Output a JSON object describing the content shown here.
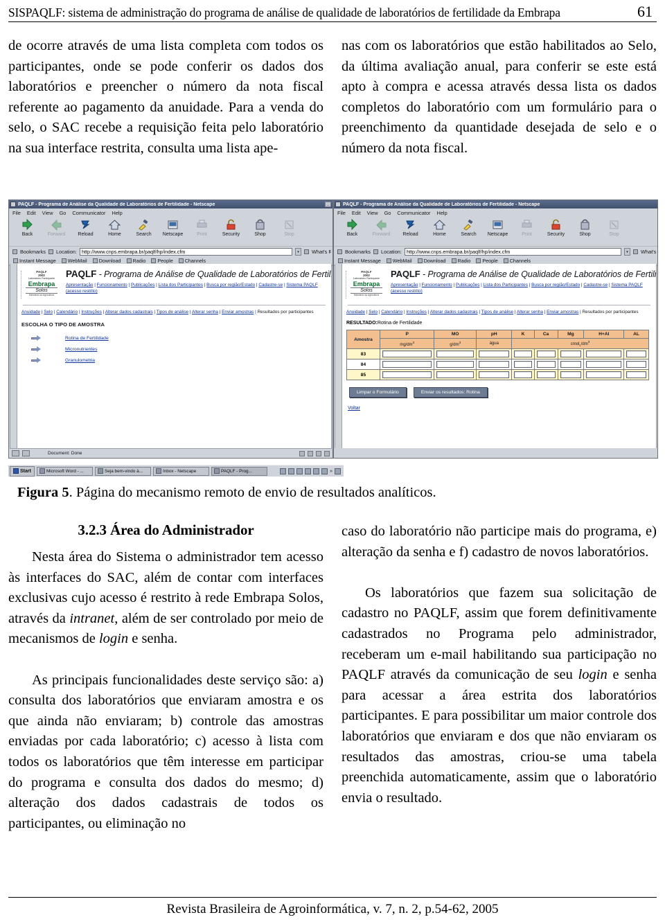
{
  "running_head": {
    "title": "SISPAQLF: sistema de administração do programa de análise de qualidade de laboratórios de fertilidade da Embrapa",
    "page_number": "61"
  },
  "columns": {
    "left_top": "de ocorre através de uma lista completa com todos os participantes, onde se pode conferir os dados dos laboratórios e preencher o número da nota fiscal referente ao pagamento da anuidade. Para a venda do selo, o SAC recebe a requisição feita pelo laboratório na sua interface restrita, consulta uma lista ape-",
    "right_top": "nas com os laboratórios que estão habilitados ao Selo, da última avaliação anual, para conferir se este está apto à compra e acessa através dessa lista os dados completos do laboratório com um formulário para o preenchimento da quantidade desejada de selo e o número da nota fiscal."
  },
  "caption": {
    "label": "Figura 5",
    "text": ". Página do mecanismo remoto de envio de resultados analíticos."
  },
  "section": {
    "heading": "3.2.3 Área do Administrador",
    "p1_a": "Nesta área do Sistema o administrador tem acesso às interfaces do SAC, além de contar com interfaces exclusivas cujo acesso é restrito à rede Embrapa Solos, através da ",
    "p1_i1": "intranet",
    "p1_b": ", além de ser controlado por meio de mecanismos de ",
    "p1_i2": "login",
    "p1_c": " e senha.",
    "p2": "As principais funcionalidades deste serviço são: a) consulta dos laboratórios que enviaram amostra e os que ainda não enviaram; b) controle das amostras enviadas por cada laboratório; c) acesso à lista com todos os laboratórios que têm interesse em participar do programa e consulta dos dados do mesmo; d) alteração dos dados cadastrais de todos os participantes, ou eliminação no",
    "p2_cont": "caso do laboratório não participe mais do programa, e) alteração da senha e f) cadastro de novos laboratórios.",
    "p3_a": "Os laboratórios que fazem sua solicitação de cadastro no PAQLF, assim que forem definitivamente cadastrados no Programa pelo administrador, receberam um e-mail habilitando sua participação no PAQLF através da comunicação de seu ",
    "p3_i1": "login",
    "p3_b": " e senha para acessar a área estrita dos laboratórios participantes. E para possibilitar um maior controle dos laboratórios que enviaram e dos que não enviaram os resultados das amostras, criou-se uma tabela preenchida automaticamente, assim que o laboratório envia o resultado."
  },
  "footer": {
    "text": "Revista Brasileira de Agroinformática, v. 7, n. 2, p.54-62,  2005"
  },
  "figure": {
    "window_title": "PAQLF - Programa de Análise da Qualidade de Laboratórios de Fertilidade - Netscape",
    "minimize_label": "_",
    "menus": [
      "File",
      "Edit",
      "View",
      "Go",
      "Communicator",
      "Help"
    ],
    "toolbar": [
      {
        "label": "Back",
        "icon": "back-arrow-icon",
        "enabled": true
      },
      {
        "label": "Forward",
        "icon": "forward-arrow-icon",
        "enabled": false
      },
      {
        "label": "Reload",
        "icon": "reload-icon",
        "enabled": true
      },
      {
        "label": "Home",
        "icon": "home-icon",
        "enabled": true
      },
      {
        "label": "Search",
        "icon": "search-flashlight-icon",
        "enabled": true
      },
      {
        "label": "Netscape",
        "icon": "netscape-icon",
        "enabled": true
      },
      {
        "label": "Print",
        "icon": "printer-icon",
        "enabled": false
      },
      {
        "label": "Security",
        "icon": "lock-icon",
        "enabled": true
      },
      {
        "label": "Shop",
        "icon": "shopping-bag-icon",
        "enabled": true
      },
      {
        "label": "Stop",
        "icon": "stop-icon",
        "enabled": false
      }
    ],
    "bookmarks_label": "Bookmarks",
    "location_label": "Location:",
    "location_value": "http://www.cnps.embrapa.br/paqlf/hp/index.cfm",
    "whats_related_label": "What's Related",
    "personal_bar": [
      "Instant Message",
      "WebMail",
      "Download",
      "Radio",
      "People",
      "Channels"
    ],
    "logo": {
      "line1": "PAQLF",
      "line2": "2002",
      "line3": "Laboratório Participante",
      "brand": "Embrapa",
      "unit": "Solos",
      "tagline": "Ministério da Agricultura"
    },
    "site_title_bold": "PAQLF",
    "site_title_rest": " - Programa de Análise de Qualidade de Laboratórios de Fertilidade",
    "main_nav": [
      "Apresentação",
      "Funcionamento",
      "Publicações",
      "Lista dos Participantes",
      "Busca por região/Estado",
      "Cadastre-se",
      "Sistema PAQLF (acesso restrito)"
    ],
    "sub_nav": [
      "Anuidade",
      "Selo",
      "Calendário",
      "Instruções",
      "Alterar dados cadastrais",
      "Tipos de análise",
      "Alterar senha",
      "Enviar amostras"
    ],
    "sub_nav_last": "Resultados por participantes",
    "left_page": {
      "section_title": "ESCOLHA O TIPO DE AMOSTRA",
      "links": [
        "Rotina de Fertilidade",
        "Micronutrientes",
        "Granulometria"
      ]
    },
    "right_page": {
      "result_label": "RESULTADO:",
      "result_value": "Rotina de Fertilidade",
      "table": {
        "headers": [
          "Amostra",
          "P",
          "MO",
          "pH",
          "K",
          "Ca",
          "Mg",
          "H+Al",
          "AL"
        ],
        "units": [
          "",
          "mg/dm",
          "g/dm",
          "água",
          "cmol",
          ""
        ],
        "unit_p": "mg/dm",
        "unit_p_sup": "3",
        "unit_mo": "g/dm",
        "unit_mo_sup": "3",
        "unit_ph": "água",
        "unit_group": "cmol",
        "unit_group_sub": "c",
        "unit_group_mid": "/dm",
        "unit_group_sup": "3",
        "rows": [
          "83",
          "84",
          "85"
        ]
      },
      "buttons": [
        "Limpar o Formulário",
        "Enviar os resultados: Rotina"
      ],
      "back_link": "Voltar"
    },
    "status_text": "Document: Done",
    "taskbar": {
      "start_label": "Start",
      "items": [
        "Microsoft Word - ...",
        "Seja bem-vindo à...",
        "Inbox - Netscape",
        "PAQLF - Prog..."
      ],
      "overflow": "»"
    }
  }
}
